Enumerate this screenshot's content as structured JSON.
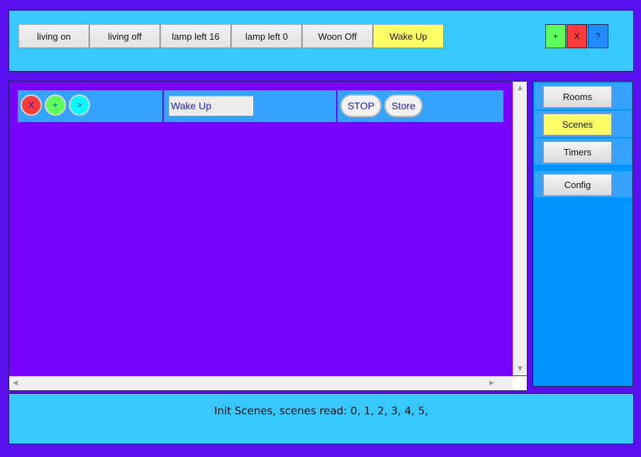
{
  "top_bar": {
    "scene_buttons": [
      "living on",
      "living off",
      "lamp left 16",
      "lamp left 0",
      "Woon Off",
      "Wake Up"
    ],
    "active_scene": "Wake Up",
    "add_label": "+",
    "close_label": "X",
    "help_label": "?"
  },
  "scene_row": {
    "delete_label": "X",
    "add_label": "+",
    "next_label": ">",
    "name_value": "Wake Up",
    "stop_label": "STOP",
    "store_label": "Store"
  },
  "sidebar": {
    "items": [
      {
        "label": "Rooms"
      },
      {
        "label": "Scenes"
      },
      {
        "label": "Timers"
      },
      {
        "label": "Config"
      }
    ],
    "active": "Scenes"
  },
  "status": {
    "message": "Init Scenes, scenes read: 0, 1, 2, 3, 4, 5,"
  },
  "colors": {
    "background": "#5a10ee",
    "panel_light": "#36c8ff",
    "main_area": "#7703fe",
    "row": "#34a4ff",
    "active_yellow": "#ffff66",
    "add_green": "#5cff5c",
    "delete_red": "#ff3a3a",
    "next_cyan": "#00ffff",
    "help_blue": "#1f8cff"
  }
}
